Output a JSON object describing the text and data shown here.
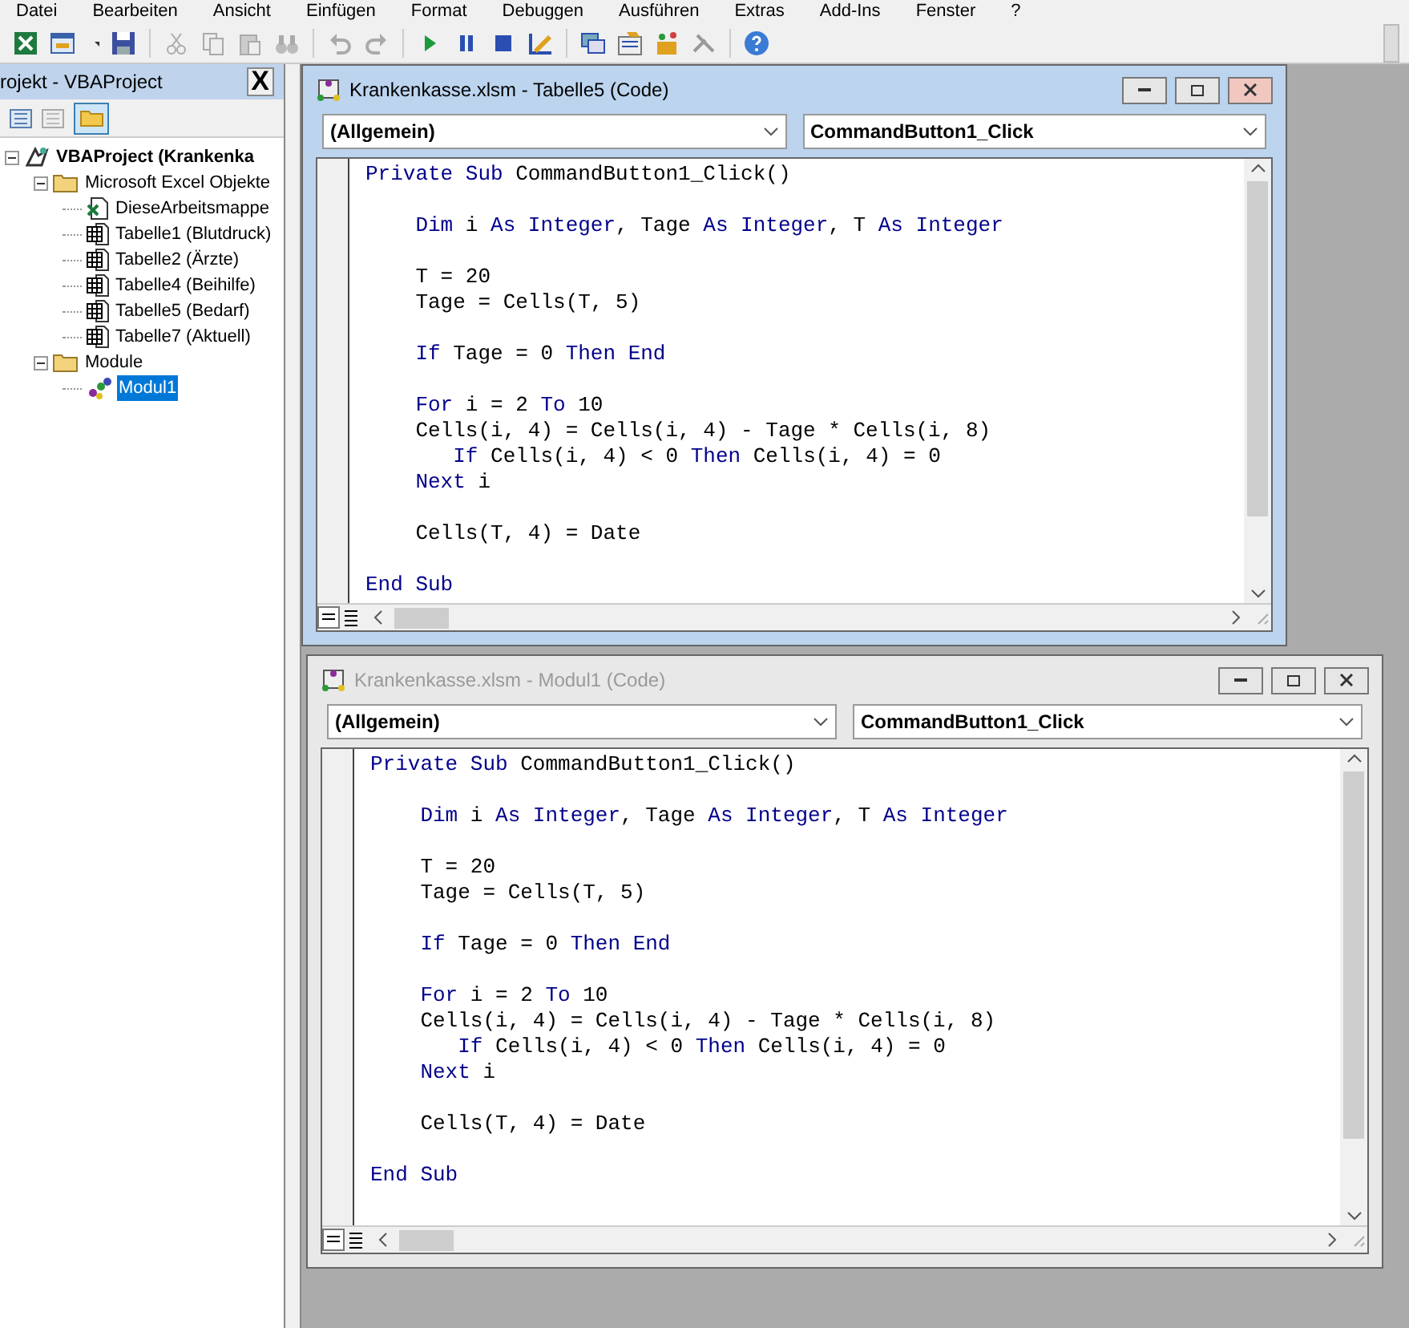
{
  "menu": [
    "Datei",
    "Bearbeiten",
    "Ansicht",
    "Einfügen",
    "Format",
    "Debuggen",
    "Ausführen",
    "Extras",
    "Add-Ins",
    "Fenster",
    "?"
  ],
  "project_panel": {
    "title": "rojekt - VBAProject",
    "close": "X",
    "tree": [
      {
        "label": "VBAProject (Krankenka",
        "kind": "project",
        "expanded": true,
        "selected": false,
        "children": [
          {
            "label": "Microsoft Excel Objekte",
            "kind": "folder",
            "expanded": true,
            "selected": false,
            "children": [
              {
                "label": "DieseArbeitsmappe",
                "kind": "workbook",
                "selected": false
              },
              {
                "label": "Tabelle1 (Blutdruck)",
                "kind": "sheet",
                "selected": false
              },
              {
                "label": "Tabelle2 (Ärzte)",
                "kind": "sheet",
                "selected": false
              },
              {
                "label": "Tabelle4 (Beihilfe)",
                "kind": "sheet",
                "selected": false
              },
              {
                "label": "Tabelle5 (Bedarf)",
                "kind": "sheet",
                "selected": false
              },
              {
                "label": "Tabelle7 (Aktuell)",
                "kind": "sheet",
                "selected": false
              }
            ]
          },
          {
            "label": "Module",
            "kind": "folder",
            "expanded": true,
            "selected": false,
            "children": [
              {
                "label": "Modul1",
                "kind": "module",
                "selected": true
              }
            ]
          }
        ]
      }
    ]
  },
  "windows": [
    {
      "title": "Krankenkasse.xlsm - Tabelle5 (Code)",
      "active": true,
      "object": "(Allgemein)",
      "procedure": "CommandButton1_Click",
      "lines": [
        [
          {
            "t": "Private Sub",
            "kind": "keyword"
          },
          {
            "t": " CommandButton1_Click()",
            "kind": "plain"
          }
        ],
        [
          {
            "t": "    Dim",
            "kind": "keyword"
          },
          {
            "t": " i ",
            "kind": "plain"
          },
          {
            "t": "As Integer",
            "kind": "keyword"
          },
          {
            "t": ", Tage ",
            "kind": "plain"
          },
          {
            "t": "As Integer",
            "kind": "keyword"
          },
          {
            "t": ", T ",
            "kind": "plain"
          },
          {
            "t": "As Integer",
            "kind": "keyword"
          }
        ],
        [
          {
            "t": "    T = 20",
            "kind": "plain"
          }
        ],
        [
          {
            "t": "    Tage = Cells(T, 5)",
            "kind": "plain"
          }
        ],
        [
          {
            "t": "    If",
            "kind": "keyword"
          },
          {
            "t": " Tage = 0 ",
            "kind": "plain"
          },
          {
            "t": "Then End",
            "kind": "keyword"
          }
        ],
        [
          {
            "t": "    For",
            "kind": "keyword"
          },
          {
            "t": " i = 2 ",
            "kind": "plain"
          },
          {
            "t": "To",
            "kind": "keyword"
          },
          {
            "t": " 10",
            "kind": "plain"
          }
        ],
        [
          {
            "t": "    Cells(i, 4) = Cells(i, 4) - Tage * Cells(i, 8)",
            "kind": "plain"
          }
        ],
        [
          {
            "t": "       If",
            "kind": "keyword"
          },
          {
            "t": " Cells(i, 4) < 0 ",
            "kind": "plain"
          },
          {
            "t": "Then",
            "kind": "keyword"
          },
          {
            "t": " Cells(i, 4) = 0",
            "kind": "plain"
          }
        ],
        [
          {
            "t": "    Next",
            "kind": "keyword"
          },
          {
            "t": " i",
            "kind": "plain"
          }
        ],
        [
          {
            "t": "    Cells(T, 4) = Date",
            "kind": "plain"
          }
        ],
        [
          {
            "t": "End Sub",
            "kind": "keyword"
          }
        ]
      ]
    },
    {
      "title": "Krankenkasse.xlsm - Modul1 (Code)",
      "active": false,
      "object": "(Allgemein)",
      "procedure": "CommandButton1_Click",
      "lines": [
        [
          {
            "t": "Private Sub",
            "kind": "keyword"
          },
          {
            "t": " CommandButton1_Click()",
            "kind": "plain"
          }
        ],
        [
          {
            "t": "    Dim",
            "kind": "keyword"
          },
          {
            "t": " i ",
            "kind": "plain"
          },
          {
            "t": "As Integer",
            "kind": "keyword"
          },
          {
            "t": ", Tage ",
            "kind": "plain"
          },
          {
            "t": "As Integer",
            "kind": "keyword"
          },
          {
            "t": ", T ",
            "kind": "plain"
          },
          {
            "t": "As Integer",
            "kind": "keyword"
          }
        ],
        [
          {
            "t": "    T = 20",
            "kind": "plain"
          }
        ],
        [
          {
            "t": "    Tage = Cells(T, 5)",
            "kind": "plain"
          }
        ],
        [
          {
            "t": "    If",
            "kind": "keyword"
          },
          {
            "t": " Tage = 0 ",
            "kind": "plain"
          },
          {
            "t": "Then End",
            "kind": "keyword"
          }
        ],
        [
          {
            "t": "    For",
            "kind": "keyword"
          },
          {
            "t": " i = 2 ",
            "kind": "plain"
          },
          {
            "t": "To",
            "kind": "keyword"
          },
          {
            "t": " 10",
            "kind": "plain"
          }
        ],
        [
          {
            "t": "    Cells(i, 4) = Cells(i, 4) - Tage * Cells(i, 8)",
            "kind": "plain"
          }
        ],
        [
          {
            "t": "       If",
            "kind": "keyword"
          },
          {
            "t": " Cells(i, 4) < 0 ",
            "kind": "plain"
          },
          {
            "t": "Then",
            "kind": "keyword"
          },
          {
            "t": " Cells(i, 4) = 0",
            "kind": "plain"
          }
        ],
        [
          {
            "t": "    Next",
            "kind": "keyword"
          },
          {
            "t": " i",
            "kind": "plain"
          }
        ],
        [
          {
            "t": "    Cells(T, 4) = Date",
            "kind": "plain"
          }
        ],
        [
          {
            "t": "End Sub",
            "kind": "keyword"
          }
        ]
      ]
    }
  ]
}
